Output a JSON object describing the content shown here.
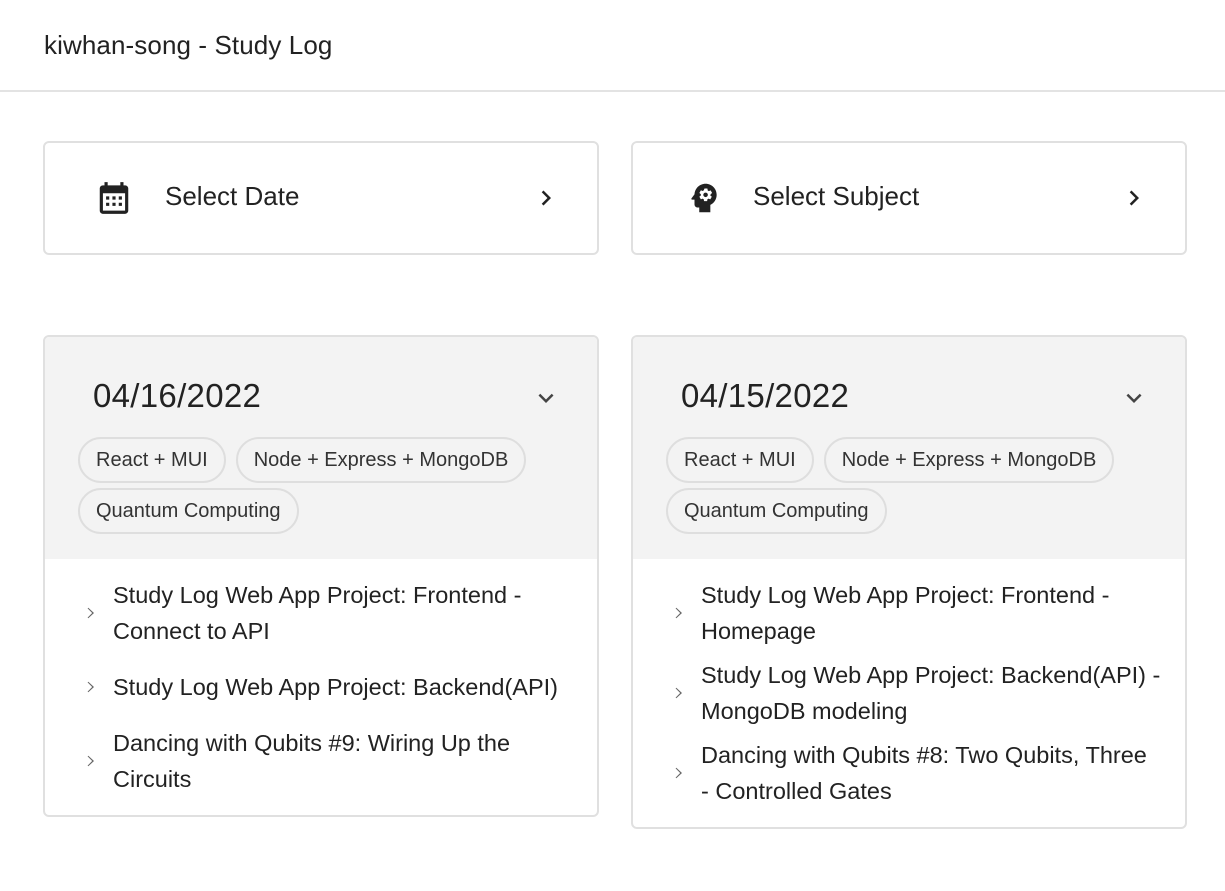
{
  "appbar": {
    "title": "kiwhan-song - Study Log"
  },
  "selectors": {
    "date": {
      "label": "Select Date",
      "icon": "calendar-icon"
    },
    "subject": {
      "label": "Select Subject",
      "icon": "psychology-icon"
    }
  },
  "days": [
    {
      "date": "04/16/2022",
      "chips": [
        "React + MUI",
        "Node + Express + MongoDB",
        "Quantum Computing"
      ],
      "logs": [
        "Study Log Web App Project: Frontend - Connect to API",
        "Study Log Web App Project: Backend(API)",
        "Dancing with Qubits #9: Wiring Up the Circuits"
      ]
    },
    {
      "date": "04/15/2022",
      "chips": [
        "React + MUI",
        "Node + Express + MongoDB",
        "Quantum Computing"
      ],
      "logs": [
        "Study Log Web App Project: Frontend - Homepage",
        "Study Log Web App Project: Backend(API) - MongoDB modeling",
        "Dancing with Qubits #8: Two Qubits, Three - Controlled Gates"
      ]
    }
  ]
}
